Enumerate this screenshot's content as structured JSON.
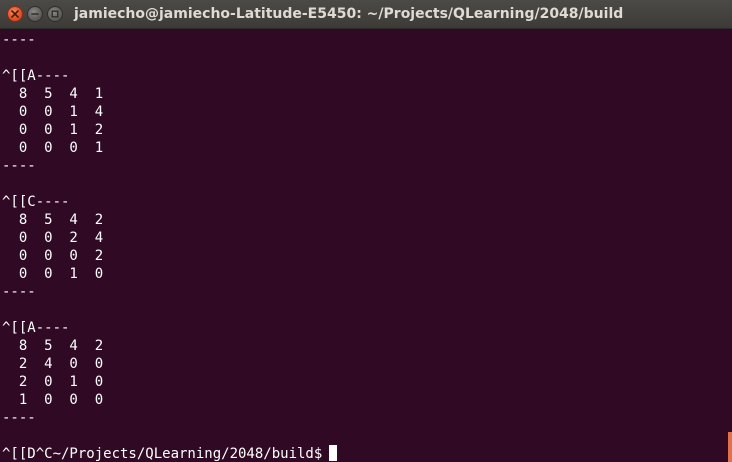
{
  "window": {
    "title": "jamiecho@jamiecho-Latitude-E5450: ~/Projects/QLearning/2048/build",
    "buttons": [
      "close-icon",
      "minimize-icon",
      "maximize-icon"
    ]
  },
  "terminal": {
    "lines": [
      "----",
      "",
      "^[[A----",
      "  8  5  4  1",
      "  0  0  1  4",
      "  0  0  1  2",
      "  0  0  0  1",
      "----",
      "",
      "^[[C----",
      "  8  5  4  2",
      "  0  0  2  4",
      "  0  0  0  2",
      "  0  0  1  0",
      "----",
      "",
      "^[[A----",
      "  8  5  4  2",
      "  2  4  0  0",
      "  2  0  1  0",
      "  1  0  0  0",
      "----",
      "",
      "^[[D^C~/Projects/QLearning/2048/build$"
    ],
    "colors": {
      "background": "#300a24",
      "foreground": "#ffffff"
    }
  }
}
